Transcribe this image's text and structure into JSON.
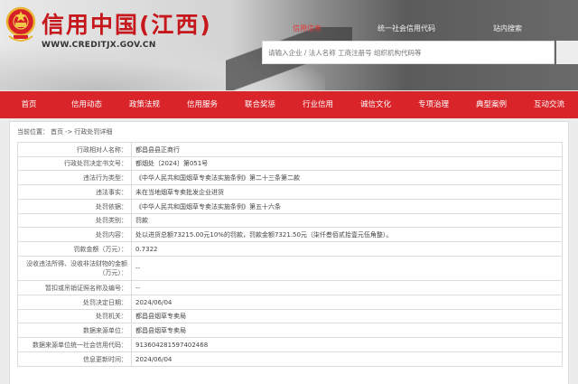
{
  "header": {
    "title": "信用中国(江西)",
    "domain": "WWW.CREDITJX.GOV.CN",
    "links": [
      "信用信息",
      "统一社会信用代码",
      "站内搜索"
    ],
    "active_link": 0,
    "search_placeholder": "请输入企业 / 法人名称 工商注册号 组织机构代码等"
  },
  "nav": {
    "items": [
      "首页",
      "信用动态",
      "政策法规",
      "信用服务",
      "联合奖惩",
      "行业信用",
      "诚信文化",
      "专项治理",
      "典型案例",
      "互动交流"
    ]
  },
  "breadcrumb": {
    "label": "当前位置：",
    "home": "首页",
    "sep1": "->",
    "current": "行政处罚详细"
  },
  "details": [
    {
      "key": "行政相对人名称：",
      "value": "都昌县县正商行"
    },
    {
      "key": "行政处罚决定书文号：",
      "value": "都烟处〔2024〕第051号"
    },
    {
      "key": "违法行为类型：",
      "value": "《中华人民共和国烟草专卖法实施条例》第二十三条第二款"
    },
    {
      "key": "违法事实：",
      "value": "未在当地烟草专卖批发企业进货"
    },
    {
      "key": "处罚依据：",
      "value": "《中华人民共和国烟草专卖法实施条例》第五十六条"
    },
    {
      "key": "处罚类别：",
      "value": "罚款"
    },
    {
      "key": "处罚内容：",
      "value": "处以进货总额73215.00元10%的罚款，罚款金额7321.50元（柒仟叁佰贰拾壹元伍角整）。"
    },
    {
      "key": "罚款金额（万元）：",
      "value": "0.7322"
    },
    {
      "key": "没收违法所得、没收非法财物的金额（万元）：",
      "value": "--"
    },
    {
      "key": "暂扣或吊销证照名称及编号：",
      "value": "--"
    },
    {
      "key": "处罚决定日期：",
      "value": "2024/06/04"
    },
    {
      "key": "处罚机关：",
      "value": "都昌县烟草专卖局"
    },
    {
      "key": "数据来源单位：",
      "value": "都昌县烟草专卖局"
    },
    {
      "key": "数据来源单位统一社会信用代码：",
      "value": "913604281597402468"
    },
    {
      "key": "信息更新时间：",
      "value": "2024/06/04"
    }
  ],
  "colors": {
    "brand_red": "#c6171c",
    "nav_red": "#d9242a"
  }
}
